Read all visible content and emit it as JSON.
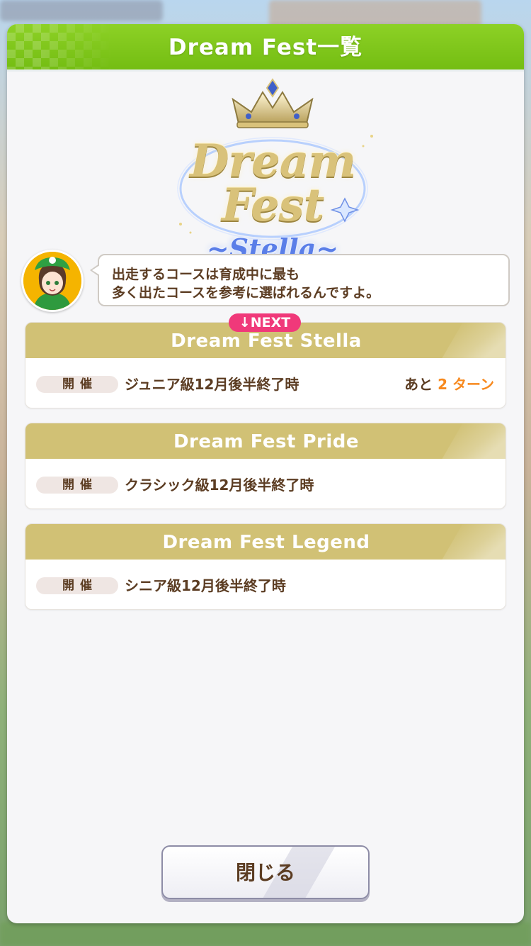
{
  "dialog": {
    "title": "Dream Fest一覧",
    "header_color": "#7cc41a"
  },
  "logo": {
    "line1": "Dream",
    "line2": "Fest",
    "subtitle": "~Stella~"
  },
  "speech": {
    "line1": "出走するコースは育成中に最も",
    "line2": "多く出たコースを参考に選ばれるんですよ。"
  },
  "next_badge": "↓NEXT",
  "fests": [
    {
      "title": "Dream Fest Stella",
      "held_label": "開催",
      "when": "ジュニア級12月後半終了時",
      "remaining_prefix": "あと",
      "remaining_turns": "2",
      "remaining_unit": "ターン"
    },
    {
      "title": "Dream Fest Pride",
      "held_label": "開催",
      "when": "クラシック級12月後半終了時"
    },
    {
      "title": "Dream Fest Legend",
      "held_label": "開催",
      "when": "シニア級12月後半終了時"
    }
  ],
  "close_button": {
    "label": "閉じる"
  },
  "colors": {
    "text_brown": "#5c3d23",
    "card_header_gold": "#d1c175",
    "next_pink": "#f0397a",
    "accent_orange": "#f7891e"
  },
  "icons": {
    "crown": "crown-icon",
    "avatar": "character-avatar"
  }
}
